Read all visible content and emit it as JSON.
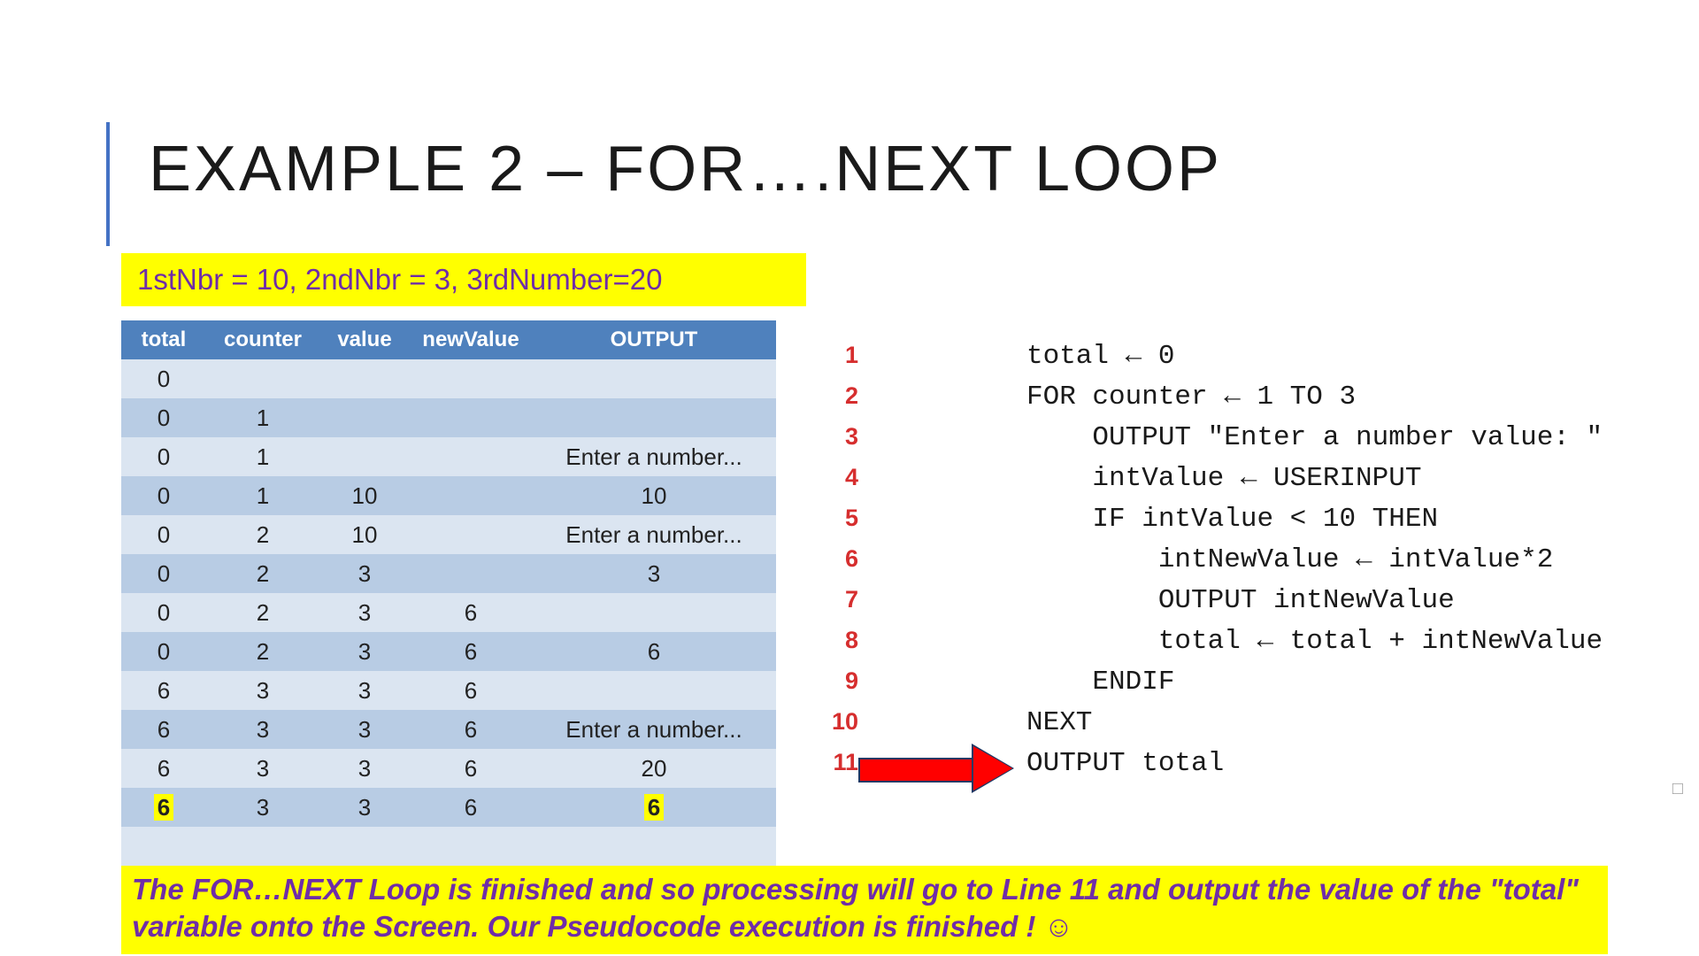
{
  "title": "EXAMPLE 2 – FOR….NEXT LOOP",
  "vars_line": "1stNbr = 10,   2ndNbr = 3,  3rdNumber=20",
  "table": {
    "headers": [
      "total",
      "counter",
      "value",
      "newValue",
      "OUTPUT"
    ],
    "rows": [
      {
        "c": [
          "0",
          "",
          "",
          "",
          ""
        ]
      },
      {
        "c": [
          "0",
          "1",
          "",
          "",
          ""
        ]
      },
      {
        "c": [
          "0",
          "1",
          "",
          "",
          "Enter a number..."
        ]
      },
      {
        "c": [
          "0",
          "1",
          "10",
          "",
          "10"
        ]
      },
      {
        "c": [
          "0",
          "2",
          "10",
          "",
          "Enter a number..."
        ]
      },
      {
        "c": [
          "0",
          "2",
          "3",
          "",
          "3"
        ]
      },
      {
        "c": [
          "0",
          "2",
          "3",
          "6",
          ""
        ]
      },
      {
        "c": [
          "0",
          "2",
          "3",
          "6",
          "6"
        ]
      },
      {
        "c": [
          "6",
          "3",
          "3",
          "6",
          ""
        ]
      },
      {
        "c": [
          "6",
          "3",
          "3",
          "6",
          "Enter a number..."
        ]
      },
      {
        "c": [
          "6",
          "3",
          "3",
          "6",
          "20"
        ]
      },
      {
        "c": [
          "6",
          "3",
          "3",
          "6",
          "6"
        ],
        "hl": [
          0,
          4
        ]
      },
      {
        "c": [
          "",
          "",
          "",
          "",
          ""
        ]
      }
    ]
  },
  "code": [
    {
      "n": "1",
      "t": "total ← 0"
    },
    {
      "n": "2",
      "t": "FOR counter ← 1 TO 3"
    },
    {
      "n": "3",
      "t": "    OUTPUT \"Enter a number value: \""
    },
    {
      "n": "4",
      "t": "    intValue ← USERINPUT"
    },
    {
      "n": "5",
      "t": "    IF intValue < 10 THEN"
    },
    {
      "n": "6",
      "t": "        intNewValue ← intValue*2"
    },
    {
      "n": "7",
      "t": "        OUTPUT intNewValue"
    },
    {
      "n": "8",
      "t": "        total ← total + intNewValue"
    },
    {
      "n": "9",
      "t": "    ENDIF"
    },
    {
      "n": "10",
      "t": "NEXT"
    },
    {
      "n": "11",
      "t": "OUTPUT total"
    }
  ],
  "footer": "The FOR…NEXT Loop is finished and so processing will go to Line 11 and output the value of the \"total\" variable onto the Screen.  Our Pseudocode execution is finished ! ☺",
  "square": "□"
}
